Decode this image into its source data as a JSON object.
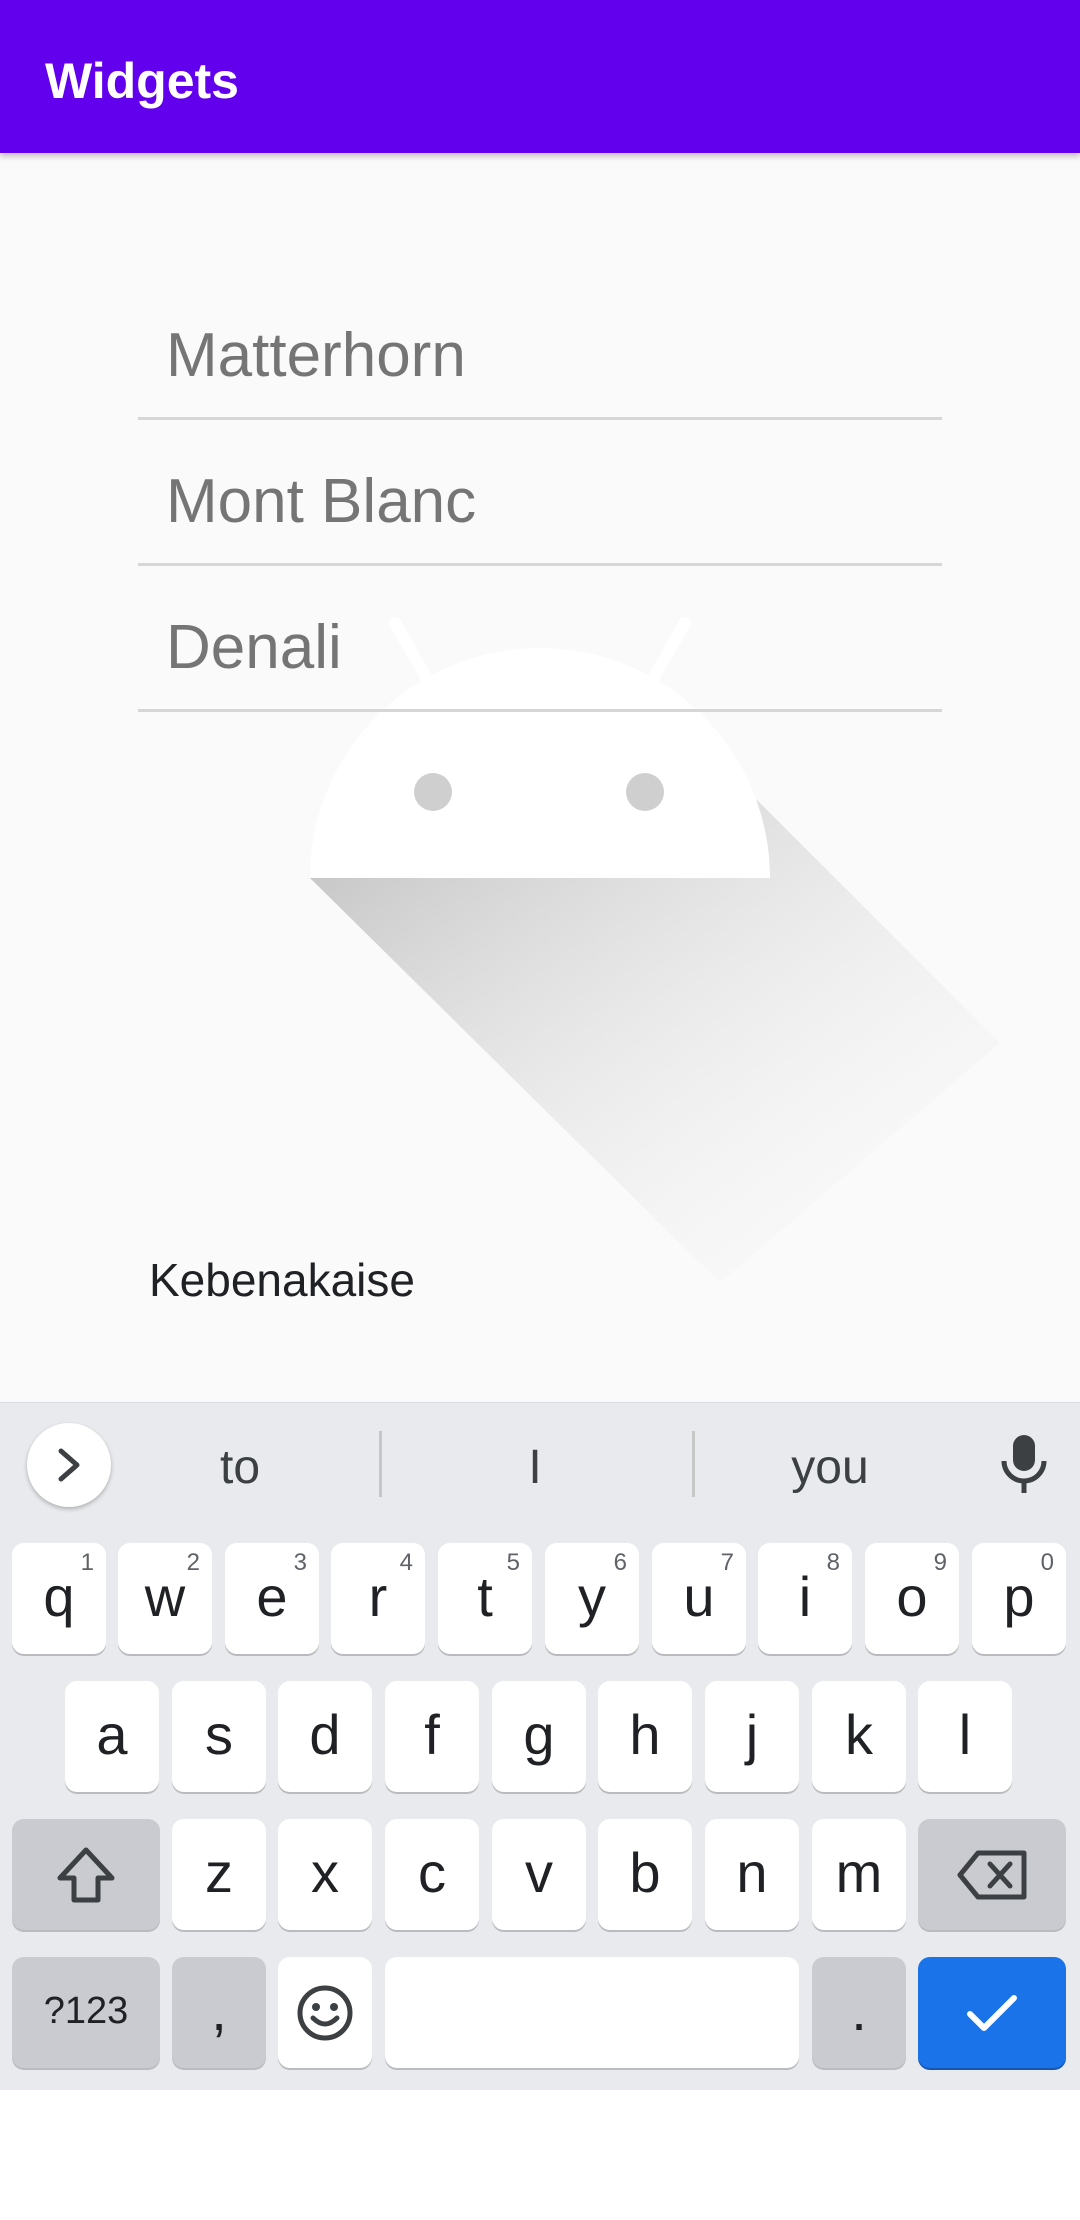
{
  "app": {
    "title": "Widgets"
  },
  "fields": [
    {
      "placeholder": "Matterhorn"
    },
    {
      "placeholder": "Mont Blanc"
    },
    {
      "placeholder": "Denali"
    }
  ],
  "label": {
    "text": "Kebenakaise"
  },
  "keyboard": {
    "suggestions": [
      "to",
      "I",
      "you"
    ],
    "row1": [
      {
        "k": "q",
        "n": "1"
      },
      {
        "k": "w",
        "n": "2"
      },
      {
        "k": "e",
        "n": "3"
      },
      {
        "k": "r",
        "n": "4"
      },
      {
        "k": "t",
        "n": "5"
      },
      {
        "k": "y",
        "n": "6"
      },
      {
        "k": "u",
        "n": "7"
      },
      {
        "k": "i",
        "n": "8"
      },
      {
        "k": "o",
        "n": "9"
      },
      {
        "k": "p",
        "n": "0"
      }
    ],
    "row2": [
      "a",
      "s",
      "d",
      "f",
      "g",
      "h",
      "j",
      "k",
      "l"
    ],
    "row3": [
      "z",
      "x",
      "c",
      "v",
      "b",
      "n",
      "m"
    ],
    "symbols_label": "?123",
    "comma": ",",
    "period": ".",
    "accent": "#1a73e8"
  },
  "colors": {
    "appbar": "#6200ee",
    "background": "#fafafa"
  }
}
